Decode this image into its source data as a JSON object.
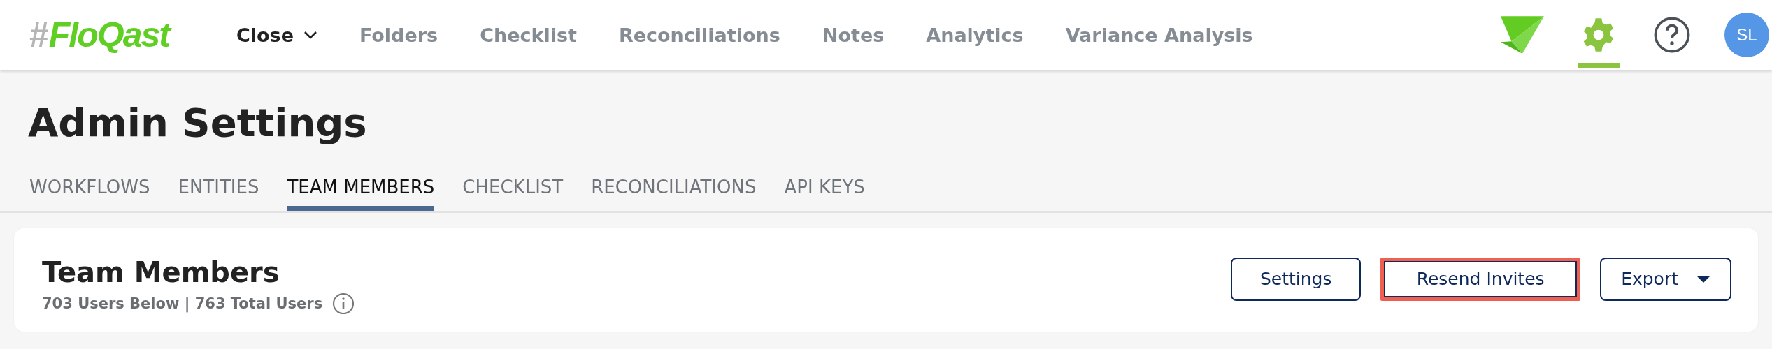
{
  "top_nav": {
    "logo": {
      "mark": "#",
      "name": "FloQast"
    },
    "items": [
      {
        "label": "Close",
        "selected": true,
        "kind": "dropdown"
      },
      {
        "label": "Folders",
        "selected": false,
        "kind": "link"
      },
      {
        "label": "Checklist",
        "selected": false,
        "kind": "link"
      },
      {
        "label": "Reconciliations",
        "selected": false,
        "kind": "link"
      },
      {
        "label": "Notes",
        "selected": false,
        "kind": "link"
      },
      {
        "label": "Analytics",
        "selected": false,
        "kind": "link"
      },
      {
        "label": "Variance Analysis",
        "selected": false,
        "kind": "link"
      }
    ],
    "actions": [
      {
        "kind": "app",
        "selected": false
      },
      {
        "kind": "settings",
        "selected": true
      },
      {
        "kind": "help",
        "selected": false
      }
    ],
    "avatar": {
      "initials": "SL"
    }
  },
  "page": {
    "title": "Admin Settings",
    "tabs": [
      {
        "label": "WORKFLOWS",
        "selected": false
      },
      {
        "label": "ENTITIES",
        "selected": false
      },
      {
        "label": "TEAM MEMBERS",
        "selected": true
      },
      {
        "label": "CHECKLIST",
        "selected": false
      },
      {
        "label": "RECONCILIATIONS",
        "selected": false
      },
      {
        "label": "API KEYS",
        "selected": false
      }
    ]
  },
  "card": {
    "title": "Team Members",
    "subtitle": "703 Users Below | 763 Total Users",
    "buttons": [
      {
        "label": "Settings",
        "kind": "plain",
        "highlighted": false
      },
      {
        "label": "Resend Invites",
        "kind": "plain",
        "highlighted": true
      },
      {
        "label": "Export",
        "kind": "dropdown",
        "highlighted": false
      }
    ]
  }
}
